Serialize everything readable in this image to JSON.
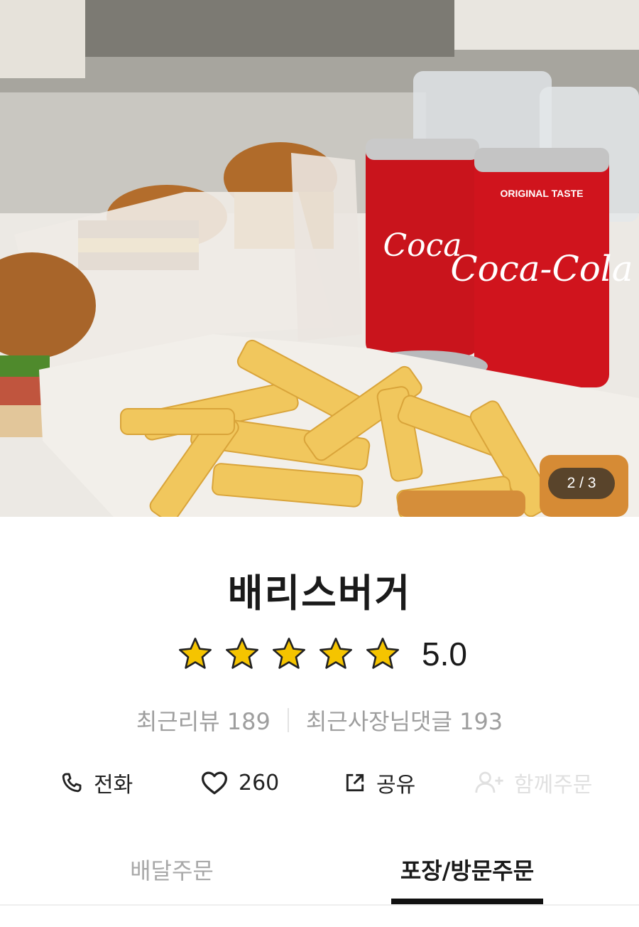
{
  "hero": {
    "counter": "2 / 3"
  },
  "store": {
    "name": "배리스버거",
    "rating": 5.0,
    "rating_label": "5.0",
    "stars_filled": 5,
    "stars_total": 5
  },
  "reviews": {
    "recent_reviews": "최근리뷰 189",
    "owner_replies": "최근사장님댓글 193"
  },
  "actions": {
    "call_label": "전화",
    "like_count": "260",
    "share_label": "공유",
    "group_order_label": "함께주문"
  },
  "tabs": {
    "delivery": "배달주문",
    "pickup": "포장/방문주문",
    "active": "pickup"
  },
  "colors": {
    "star": "#f5c400",
    "active_tab": "#111111",
    "inactive_text": "#a8a8a8"
  }
}
